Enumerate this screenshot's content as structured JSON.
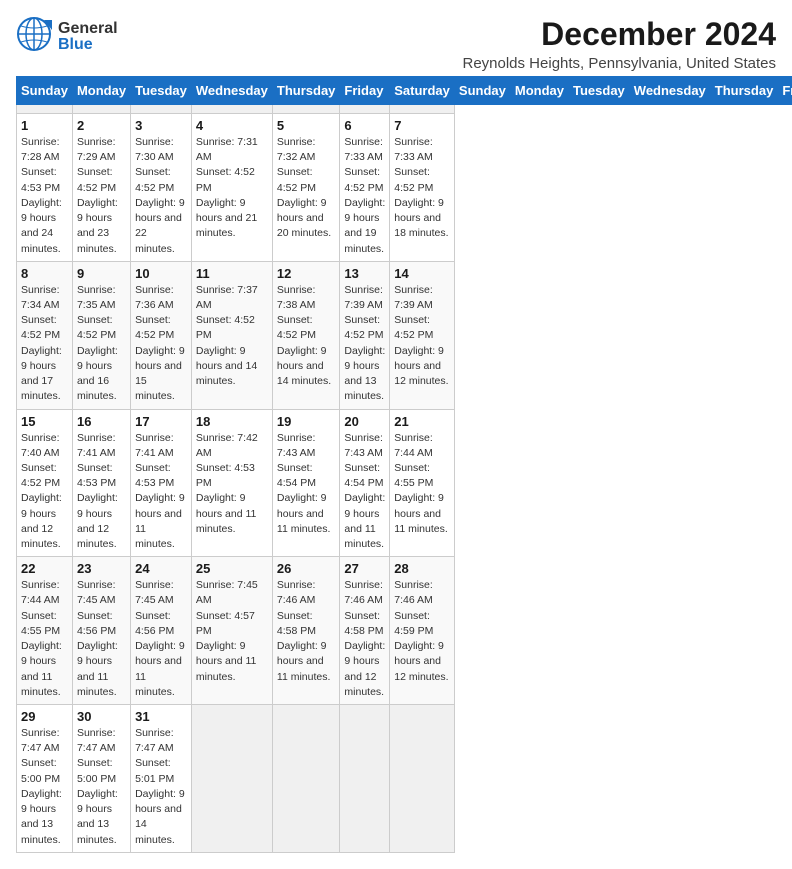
{
  "header": {
    "logo_general": "General",
    "logo_blue": "Blue",
    "title": "December 2024",
    "subtitle": "Reynolds Heights, Pennsylvania, United States"
  },
  "calendar": {
    "days_of_week": [
      "Sunday",
      "Monday",
      "Tuesday",
      "Wednesday",
      "Thursday",
      "Friday",
      "Saturday"
    ],
    "weeks": [
      [
        {
          "day": "",
          "empty": true
        },
        {
          "day": "",
          "empty": true
        },
        {
          "day": "",
          "empty": true
        },
        {
          "day": "",
          "empty": true
        },
        {
          "day": "",
          "empty": true
        },
        {
          "day": "",
          "empty": true
        },
        {
          "day": "",
          "empty": true
        }
      ],
      [
        {
          "day": "1",
          "sunrise": "Sunrise: 7:28 AM",
          "sunset": "Sunset: 4:53 PM",
          "daylight": "Daylight: 9 hours and 24 minutes."
        },
        {
          "day": "2",
          "sunrise": "Sunrise: 7:29 AM",
          "sunset": "Sunset: 4:52 PM",
          "daylight": "Daylight: 9 hours and 23 minutes."
        },
        {
          "day": "3",
          "sunrise": "Sunrise: 7:30 AM",
          "sunset": "Sunset: 4:52 PM",
          "daylight": "Daylight: 9 hours and 22 minutes."
        },
        {
          "day": "4",
          "sunrise": "Sunrise: 7:31 AM",
          "sunset": "Sunset: 4:52 PM",
          "daylight": "Daylight: 9 hours and 21 minutes."
        },
        {
          "day": "5",
          "sunrise": "Sunrise: 7:32 AM",
          "sunset": "Sunset: 4:52 PM",
          "daylight": "Daylight: 9 hours and 20 minutes."
        },
        {
          "day": "6",
          "sunrise": "Sunrise: 7:33 AM",
          "sunset": "Sunset: 4:52 PM",
          "daylight": "Daylight: 9 hours and 19 minutes."
        },
        {
          "day": "7",
          "sunrise": "Sunrise: 7:33 AM",
          "sunset": "Sunset: 4:52 PM",
          "daylight": "Daylight: 9 hours and 18 minutes."
        }
      ],
      [
        {
          "day": "8",
          "sunrise": "Sunrise: 7:34 AM",
          "sunset": "Sunset: 4:52 PM",
          "daylight": "Daylight: 9 hours and 17 minutes."
        },
        {
          "day": "9",
          "sunrise": "Sunrise: 7:35 AM",
          "sunset": "Sunset: 4:52 PM",
          "daylight": "Daylight: 9 hours and 16 minutes."
        },
        {
          "day": "10",
          "sunrise": "Sunrise: 7:36 AM",
          "sunset": "Sunset: 4:52 PM",
          "daylight": "Daylight: 9 hours and 15 minutes."
        },
        {
          "day": "11",
          "sunrise": "Sunrise: 7:37 AM",
          "sunset": "Sunset: 4:52 PM",
          "daylight": "Daylight: 9 hours and 14 minutes."
        },
        {
          "day": "12",
          "sunrise": "Sunrise: 7:38 AM",
          "sunset": "Sunset: 4:52 PM",
          "daylight": "Daylight: 9 hours and 14 minutes."
        },
        {
          "day": "13",
          "sunrise": "Sunrise: 7:39 AM",
          "sunset": "Sunset: 4:52 PM",
          "daylight": "Daylight: 9 hours and 13 minutes."
        },
        {
          "day": "14",
          "sunrise": "Sunrise: 7:39 AM",
          "sunset": "Sunset: 4:52 PM",
          "daylight": "Daylight: 9 hours and 12 minutes."
        }
      ],
      [
        {
          "day": "15",
          "sunrise": "Sunrise: 7:40 AM",
          "sunset": "Sunset: 4:52 PM",
          "daylight": "Daylight: 9 hours and 12 minutes."
        },
        {
          "day": "16",
          "sunrise": "Sunrise: 7:41 AM",
          "sunset": "Sunset: 4:53 PM",
          "daylight": "Daylight: 9 hours and 12 minutes."
        },
        {
          "day": "17",
          "sunrise": "Sunrise: 7:41 AM",
          "sunset": "Sunset: 4:53 PM",
          "daylight": "Daylight: 9 hours and 11 minutes."
        },
        {
          "day": "18",
          "sunrise": "Sunrise: 7:42 AM",
          "sunset": "Sunset: 4:53 PM",
          "daylight": "Daylight: 9 hours and 11 minutes."
        },
        {
          "day": "19",
          "sunrise": "Sunrise: 7:43 AM",
          "sunset": "Sunset: 4:54 PM",
          "daylight": "Daylight: 9 hours and 11 minutes."
        },
        {
          "day": "20",
          "sunrise": "Sunrise: 7:43 AM",
          "sunset": "Sunset: 4:54 PM",
          "daylight": "Daylight: 9 hours and 11 minutes."
        },
        {
          "day": "21",
          "sunrise": "Sunrise: 7:44 AM",
          "sunset": "Sunset: 4:55 PM",
          "daylight": "Daylight: 9 hours and 11 minutes."
        }
      ],
      [
        {
          "day": "22",
          "sunrise": "Sunrise: 7:44 AM",
          "sunset": "Sunset: 4:55 PM",
          "daylight": "Daylight: 9 hours and 11 minutes."
        },
        {
          "day": "23",
          "sunrise": "Sunrise: 7:45 AM",
          "sunset": "Sunset: 4:56 PM",
          "daylight": "Daylight: 9 hours and 11 minutes."
        },
        {
          "day": "24",
          "sunrise": "Sunrise: 7:45 AM",
          "sunset": "Sunset: 4:56 PM",
          "daylight": "Daylight: 9 hours and 11 minutes."
        },
        {
          "day": "25",
          "sunrise": "Sunrise: 7:45 AM",
          "sunset": "Sunset: 4:57 PM",
          "daylight": "Daylight: 9 hours and 11 minutes."
        },
        {
          "day": "26",
          "sunrise": "Sunrise: 7:46 AM",
          "sunset": "Sunset: 4:58 PM",
          "daylight": "Daylight: 9 hours and 11 minutes."
        },
        {
          "day": "27",
          "sunrise": "Sunrise: 7:46 AM",
          "sunset": "Sunset: 4:58 PM",
          "daylight": "Daylight: 9 hours and 12 minutes."
        },
        {
          "day": "28",
          "sunrise": "Sunrise: 7:46 AM",
          "sunset": "Sunset: 4:59 PM",
          "daylight": "Daylight: 9 hours and 12 minutes."
        }
      ],
      [
        {
          "day": "29",
          "sunrise": "Sunrise: 7:47 AM",
          "sunset": "Sunset: 5:00 PM",
          "daylight": "Daylight: 9 hours and 13 minutes."
        },
        {
          "day": "30",
          "sunrise": "Sunrise: 7:47 AM",
          "sunset": "Sunset: 5:00 PM",
          "daylight": "Daylight: 9 hours and 13 minutes."
        },
        {
          "day": "31",
          "sunrise": "Sunrise: 7:47 AM",
          "sunset": "Sunset: 5:01 PM",
          "daylight": "Daylight: 9 hours and 14 minutes."
        },
        {
          "day": "",
          "empty": true
        },
        {
          "day": "",
          "empty": true
        },
        {
          "day": "",
          "empty": true
        },
        {
          "day": "",
          "empty": true
        }
      ]
    ]
  }
}
